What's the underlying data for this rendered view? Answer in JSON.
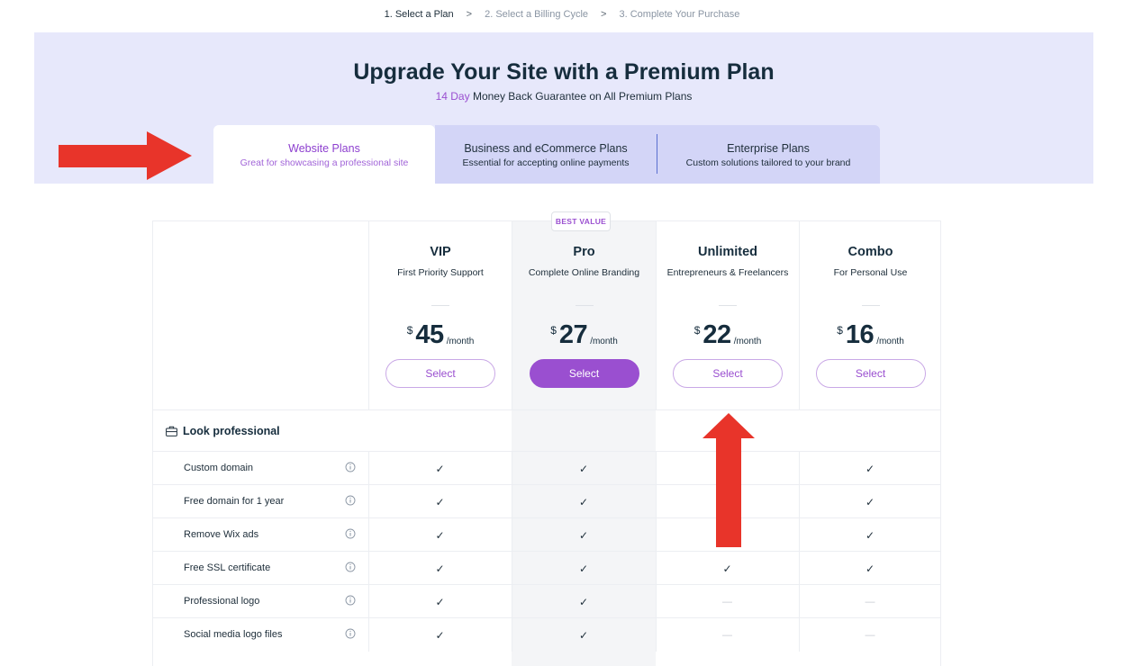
{
  "breadcrumb": [
    {
      "label": "1.  Select a Plan",
      "active": true
    },
    {
      "label": "2.  Select a Billing Cycle",
      "active": false
    },
    {
      "label": "3.  Complete Your Purchase",
      "active": false
    }
  ],
  "breadcrumb_sep": ">",
  "hero": {
    "title": "Upgrade Your Site with a Premium Plan",
    "subtitle_accent": "14 Day",
    "subtitle_rest": " Money Back Guarantee on All Premium Plans"
  },
  "tabs": [
    {
      "label": "Website Plans",
      "desc": "Great for showcasing a professional site"
    },
    {
      "label": "Business and eCommerce Plans",
      "desc": "Essential for accepting online payments"
    },
    {
      "label": "Enterprise Plans",
      "desc": "Custom solutions tailored to your brand"
    }
  ],
  "badge": "BEST VALUE",
  "plans": [
    {
      "name": "VIP",
      "desc": "First Priority Support",
      "currency": "$",
      "price": "45",
      "period": "/month",
      "button": "Select"
    },
    {
      "name": "Pro",
      "desc": "Complete Online Branding",
      "currency": "$",
      "price": "27",
      "period": "/month",
      "button": "Select"
    },
    {
      "name": "Unlimited",
      "desc": "Entrepreneurs & Freelancers",
      "currency": "$",
      "price": "22",
      "period": "/month",
      "button": "Select"
    },
    {
      "name": "Combo",
      "desc": "For Personal Use",
      "currency": "$",
      "price": "16",
      "period": "/month",
      "button": "Select"
    }
  ],
  "section": {
    "title": "Look professional",
    "icon": "briefcase-icon"
  },
  "features": [
    {
      "label": "Custom domain",
      "cells": [
        "✓",
        "✓",
        "",
        "✓"
      ]
    },
    {
      "label": "Free domain for 1 year",
      "cells": [
        "✓",
        "✓",
        "",
        "✓"
      ]
    },
    {
      "label": "Remove Wix ads",
      "cells": [
        "✓",
        "✓",
        "",
        "✓"
      ]
    },
    {
      "label": "Free SSL certificate",
      "cells": [
        "✓",
        "✓",
        "✓",
        "✓"
      ]
    },
    {
      "label": "Professional logo",
      "cells": [
        "✓",
        "✓",
        "—",
        "—"
      ]
    },
    {
      "label": "Social media logo files",
      "cells": [
        "✓",
        "✓",
        "—",
        "—"
      ]
    }
  ],
  "colors": {
    "accent": "#9a4fd0",
    "hero_bg": "#e7e8fb",
    "tab_bg": "#d3d5f7",
    "annotation_arrow": "#e8342a"
  },
  "icons": {
    "info": "info-icon",
    "check": "check-icon",
    "annotation": "red-arrow-icon"
  }
}
